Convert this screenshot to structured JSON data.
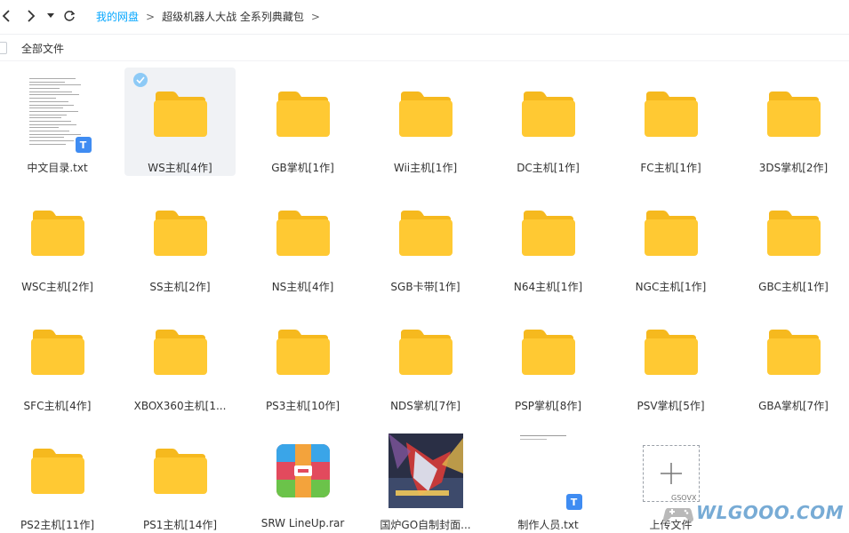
{
  "nav": {
    "back_icon": "chevron-left-icon",
    "forward_icon": "chevron-right-icon",
    "dropdown_icon": "caret-down-icon",
    "refresh_icon": "refresh-icon"
  },
  "breadcrumb": {
    "root": "我的网盘",
    "separator": ">",
    "current": "超级机器人大战 全系列典藏包",
    "trailing": ">"
  },
  "toolbar": {
    "select_all_label": "全部文件"
  },
  "colors": {
    "accent": "#06a7ff",
    "folder": "#ffc933",
    "folder_back": "#f6b91e",
    "selected_bg": "#f0f2f5"
  },
  "files": [
    {
      "name": "中文目录.txt",
      "type": "txt"
    },
    {
      "name": "WS主机[4作]",
      "type": "folder",
      "selected": true
    },
    {
      "name": "GB掌机[1作]",
      "type": "folder"
    },
    {
      "name": "Wii主机[1作]",
      "type": "folder"
    },
    {
      "name": "DC主机[1作]",
      "type": "folder"
    },
    {
      "name": "FC主机[1作]",
      "type": "folder"
    },
    {
      "name": "3DS掌机[2作]",
      "type": "folder"
    },
    {
      "name": "WSC主机[2作]",
      "type": "folder"
    },
    {
      "name": "SS主机[2作]",
      "type": "folder"
    },
    {
      "name": "NS主机[4作]",
      "type": "folder"
    },
    {
      "name": "SGB卡带[1作]",
      "type": "folder"
    },
    {
      "name": "N64主机[1作]",
      "type": "folder"
    },
    {
      "name": "NGC主机[1作]",
      "type": "folder"
    },
    {
      "name": "GBC主机[1作]",
      "type": "folder"
    },
    {
      "name": "SFC主机[4作]",
      "type": "folder"
    },
    {
      "name": "XBOX360主机[1...",
      "type": "folder"
    },
    {
      "name": "PS3主机[10作]",
      "type": "folder"
    },
    {
      "name": "NDS掌机[7作]",
      "type": "folder"
    },
    {
      "name": "PSP掌机[8作]",
      "type": "folder"
    },
    {
      "name": "PSV掌机[5作]",
      "type": "folder"
    },
    {
      "name": "GBA掌机[7作]",
      "type": "folder"
    },
    {
      "name": "PS2主机[11作]",
      "type": "folder"
    },
    {
      "name": "PS1主机[14作]",
      "type": "folder"
    },
    {
      "name": "SRW LineUp.rar",
      "type": "rar"
    },
    {
      "name": "国炉GO自制封面...",
      "type": "image"
    },
    {
      "name": "制作人员.txt",
      "type": "txt-blank"
    },
    {
      "name": "上传文件",
      "type": "upload"
    }
  ],
  "watermark": {
    "text": "WLGOOO.COM",
    "small": "GSOVX"
  }
}
